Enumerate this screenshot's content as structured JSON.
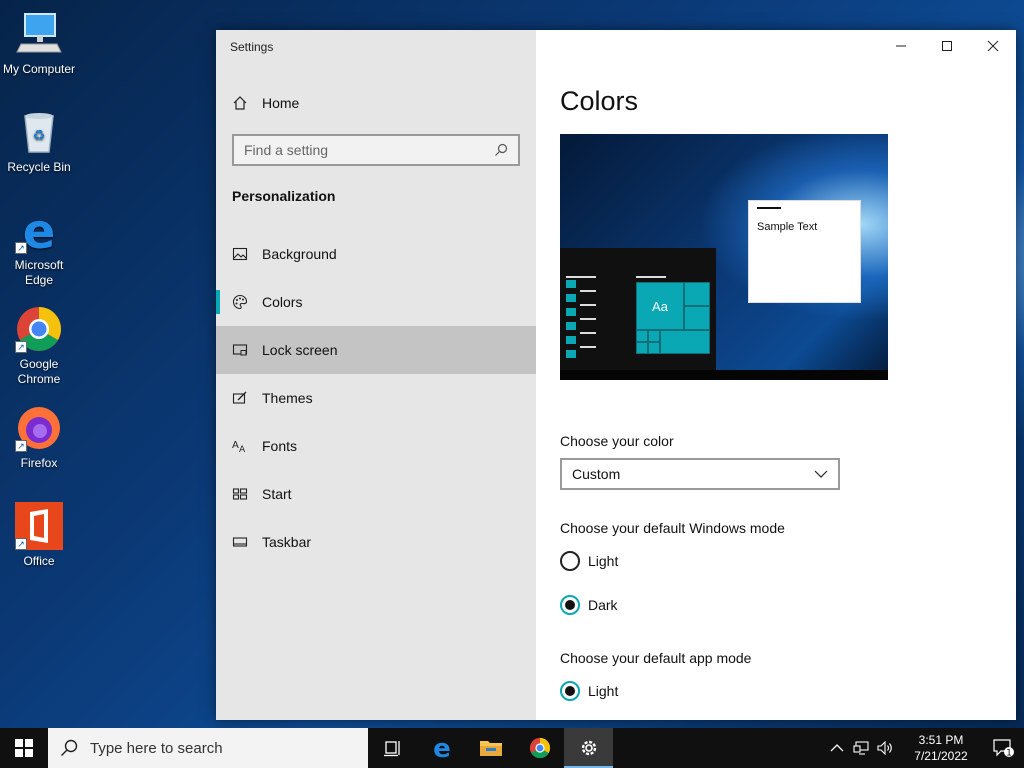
{
  "desktop": {
    "icons": [
      {
        "label": "My Computer"
      },
      {
        "label": "Recycle Bin"
      },
      {
        "label": "Microsoft Edge"
      },
      {
        "label": "Google Chrome"
      },
      {
        "label": "Firefox"
      },
      {
        "label": "Office"
      }
    ]
  },
  "window": {
    "title": "Settings",
    "home_label": "Home",
    "search_placeholder": "Find a setting",
    "section": "Personalization",
    "nav": [
      {
        "label": "Background",
        "icon": "picture-icon"
      },
      {
        "label": "Colors",
        "icon": "palette-icon",
        "active": true
      },
      {
        "label": "Lock screen",
        "icon": "lock-screen-icon",
        "hover": true
      },
      {
        "label": "Themes",
        "icon": "themes-icon"
      },
      {
        "label": "Fonts",
        "icon": "fonts-icon"
      },
      {
        "label": "Start",
        "icon": "start-icon"
      },
      {
        "label": "Taskbar",
        "icon": "taskbar-icon"
      }
    ]
  },
  "content": {
    "title": "Colors",
    "preview": {
      "sample_text": "Sample Text",
      "tile_text": "Aa"
    },
    "choose_color": {
      "label": "Choose your color",
      "selected": "Custom"
    },
    "windows_mode": {
      "label": "Choose your default Windows mode",
      "options": [
        "Light",
        "Dark"
      ],
      "selected": "Dark"
    },
    "app_mode": {
      "label": "Choose your default app mode",
      "options": [
        "Light"
      ],
      "selected": "Light"
    }
  },
  "taskbar": {
    "search_placeholder": "Type here to search",
    "clock": {
      "time": "3:51 PM",
      "date": "7/21/2022"
    },
    "notification_count": "1"
  },
  "colors": {
    "accent": "#0aa7b5"
  }
}
